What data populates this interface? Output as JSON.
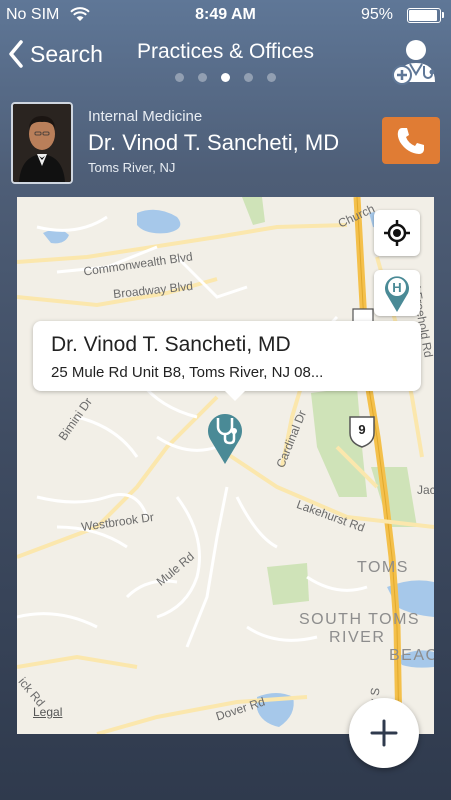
{
  "status_bar": {
    "carrier": "No SIM",
    "time": "8:49 AM",
    "battery": "95%"
  },
  "nav": {
    "back_label": "Search",
    "title": "Practices & Offices",
    "page_count": 5,
    "active_page": 3
  },
  "doctor": {
    "specialty": "Internal Medicine",
    "name": "Dr. Vinod T. Sancheti, MD",
    "location": "Toms River, NJ"
  },
  "map": {
    "streets": [
      "Commonwealth Blvd",
      "Broadway Blvd",
      "Bimini Dr",
      "Cardinal Dr",
      "Lakehurst Rd",
      "Westbrook Dr",
      "Mule Rd",
      "Dover Rd",
      "Church",
      "Old Freehold Rd",
      "ick Rd",
      "Jac",
      "way S"
    ],
    "places": [
      "TOMS",
      "SOUTH TOMS",
      "RIVER",
      "BEAC"
    ],
    "route_shield": "9",
    "callout": {
      "name": "Dr. Vinod T. Sancheti, MD",
      "address": "25 Mule Rd Unit B8, Toms River, NJ 08..."
    },
    "legal_label": "Legal"
  },
  "colors": {
    "call_button": "#e07c34",
    "pin": "#4a8a96",
    "nav_bg": "#5f7797"
  },
  "icons": {
    "back": "chevron-left-icon",
    "profile": "doctor-profile-icon",
    "call": "phone-icon",
    "locate": "crosshair-icon",
    "hospital": "hospital-pin-icon",
    "pin": "stethoscope-pin-icon",
    "add": "plus-icon"
  }
}
